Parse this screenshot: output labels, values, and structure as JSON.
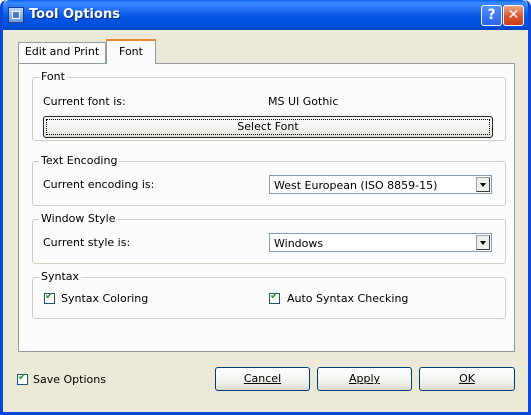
{
  "window": {
    "title": "Tool Options",
    "help_label": "?",
    "close_label": "✕"
  },
  "tabs": [
    {
      "label": "Edit and Print",
      "selected": false
    },
    {
      "label": "Font",
      "selected": true
    }
  ],
  "font_group": {
    "title": "Font",
    "current_label": "Current font is:",
    "current_value": "MS UI Gothic",
    "select_button": "Select Font"
  },
  "encoding_group": {
    "title": "Text Encoding",
    "current_label": "Current encoding is:",
    "selected": "West European (ISO 8859-15)"
  },
  "style_group": {
    "title": "Window Style",
    "current_label": "Current style is:",
    "selected": "Windows"
  },
  "syntax_group": {
    "title": "Syntax",
    "coloring_label": "Syntax Coloring",
    "coloring_checked": true,
    "auto_check_label": "Auto Syntax Checking",
    "auto_check_checked": true
  },
  "footer": {
    "save_options_label": "Save Options",
    "save_options_checked": true,
    "cancel_label": "Cancel",
    "apply_label": "Apply",
    "ok_label": "OK"
  },
  "icons": {
    "check": "✔"
  }
}
